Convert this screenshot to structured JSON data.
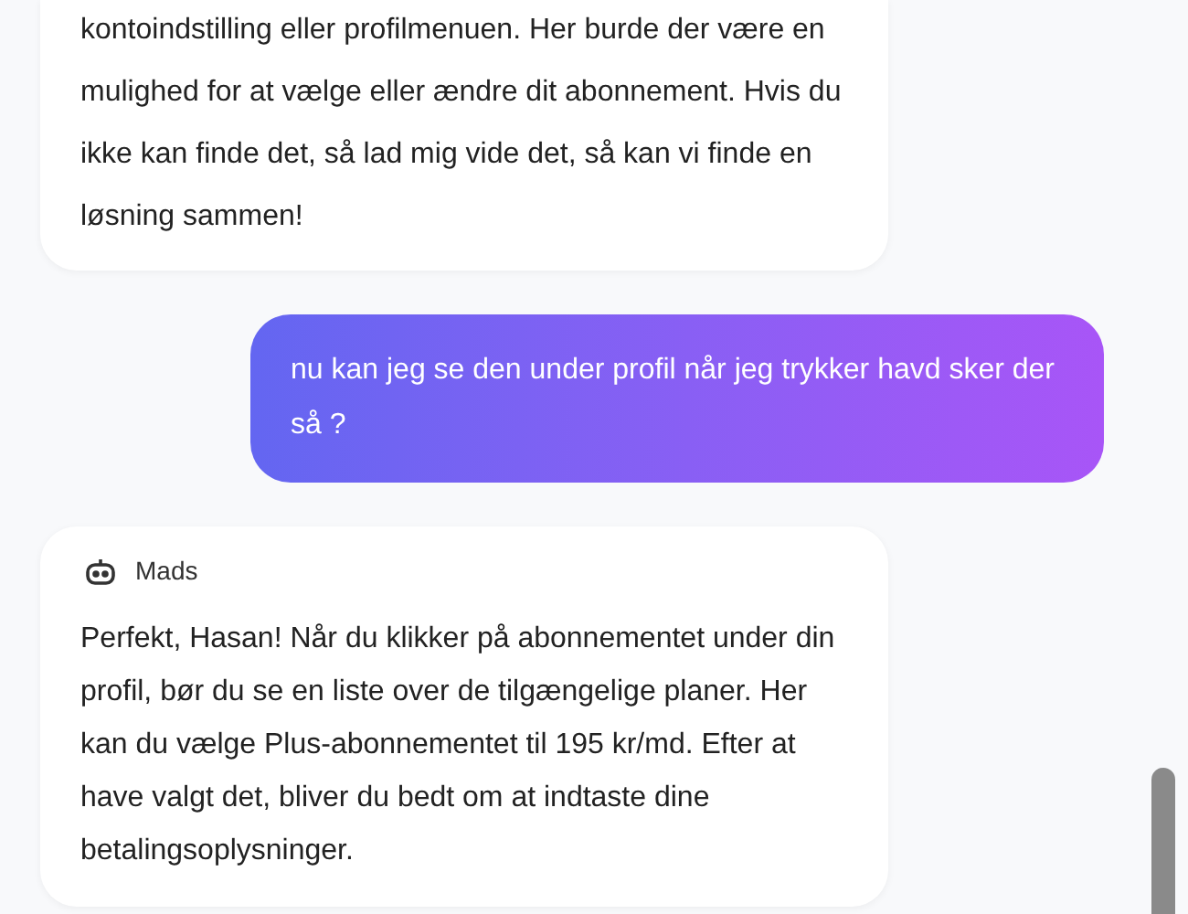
{
  "messages": [
    {
      "kind": "bot",
      "text": "kontoindstilling eller profilmenuen. Her burde der være en mulighed for at vælge eller ændre dit abonnement. Hvis du ikke kan finde det, så lad mig vide det, så kan vi finde en løsning sammen!"
    },
    {
      "kind": "user",
      "text": "nu kan jeg se den under profil når jeg trykker havd sker der så ?"
    },
    {
      "kind": "bot",
      "sender": "Mads",
      "text": "Perfekt, Hasan! Når du klikker på abonnementet under din profil, bør du se en liste over de tilgængelige planer. Her kan du vælge Plus-abonnementet til 195 kr/md. Efter at have valgt det, bliver du bedt om at indtaste dine betalingsoplysninger."
    }
  ]
}
